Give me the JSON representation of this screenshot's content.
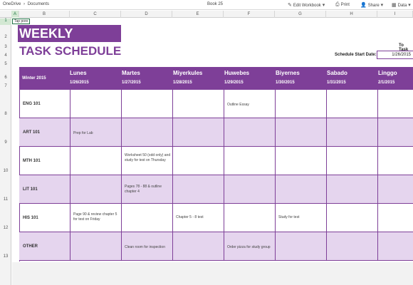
{
  "topbar": {
    "breadcrumb": [
      "OneDrive",
      "›",
      "Documents"
    ],
    "doc_title": "Book 25",
    "edit_workbook": "Edit Workbook",
    "print": "Print",
    "share": "Share",
    "data": "Data"
  },
  "columns": [
    "A",
    "B",
    "C",
    "D",
    "E",
    "F",
    "G",
    "H",
    "I"
  ],
  "rows": [
    "1",
    "2",
    "3",
    "4",
    "5",
    "6",
    "7",
    "8",
    "9",
    "10",
    "11",
    "12",
    "13"
  ],
  "cell_note": "Tap pore",
  "title": "WEEKLY",
  "subtitle": "TASK SCHEDULE",
  "to_task": "To Task",
  "start_label": "Schedule Start Date:",
  "start_date": "1/26/2015",
  "season": "Winter 2015",
  "days": [
    "Lunes",
    "Martes",
    "Miyerkules",
    "Huwebes",
    "Biyernes",
    "Sabado",
    "Linggo"
  ],
  "dates": [
    "1/26/2015",
    "1/27/2015",
    "1/28/2015",
    "1/29/2015",
    "1/30/2015",
    "1/31/2015",
    "2/1/2015"
  ],
  "schedule": [
    {
      "subject": "ENG 101",
      "notes": [
        "",
        "",
        "",
        "Outline Essay",
        "",
        "",
        ""
      ]
    },
    {
      "subject": "ART 101",
      "notes": [
        "Prep for Lab",
        "",
        "",
        "",
        "",
        "",
        ""
      ]
    },
    {
      "subject": "MTH 101",
      "notes": [
        "",
        "Worksheet 50 (odd only) and study for test on Thursday",
        "",
        "",
        "",
        "",
        ""
      ]
    },
    {
      "subject": "LIT 101",
      "notes": [
        "",
        "Pages 78 - 88 & outline chapter 4",
        "",
        "",
        "",
        "",
        ""
      ]
    },
    {
      "subject": "HIS 101",
      "notes": [
        "Page 90 & review chapter 5 for test on Friday",
        "",
        "Chapter 5 - 8 test",
        "",
        "Study for test",
        "",
        ""
      ]
    },
    {
      "subject": "OTHER",
      "notes": [
        "",
        "Clean room for inspection",
        "",
        "Order pizza for study group",
        "",
        "",
        ""
      ]
    }
  ],
  "colors": {
    "accent": "#7e3f98",
    "alt_row": "#e5d5ee",
    "excel_green": "#217346"
  }
}
